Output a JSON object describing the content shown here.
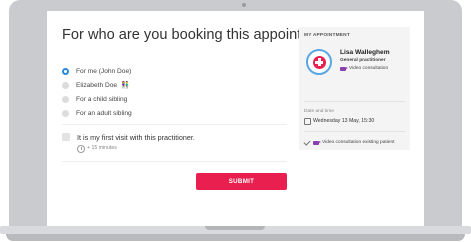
{
  "page": {
    "title": "For who are you booking this appointment?",
    "options": [
      {
        "label": "For me (John Doe)",
        "selected": true
      },
      {
        "label": "Elizabeth Doe",
        "selected": false,
        "icon": "sibling-icon"
      },
      {
        "label": "For a child sibling",
        "selected": false
      },
      {
        "label": "For an adult sibling",
        "selected": false
      }
    ],
    "first_visit_label": "It is my first visit with this practitioner.",
    "extra_time": "+ 15 minutes",
    "submit_label": "SUBMIT"
  },
  "appointment": {
    "heading": "MY APPOINTMENT",
    "practitioner_name": "Lisa Walleghem",
    "specialty": "General practitioner",
    "consultation_type": "Video consultation",
    "date_label": "Date and time",
    "date_value": "Wednesday 13 May, 15:30",
    "status": "Video consultation existing patient"
  },
  "colors": {
    "accent": "#e9204f",
    "selected_radio": "#2b8ad8",
    "video": "#8a3fb0",
    "panel_bg": "#f4f4f5"
  }
}
